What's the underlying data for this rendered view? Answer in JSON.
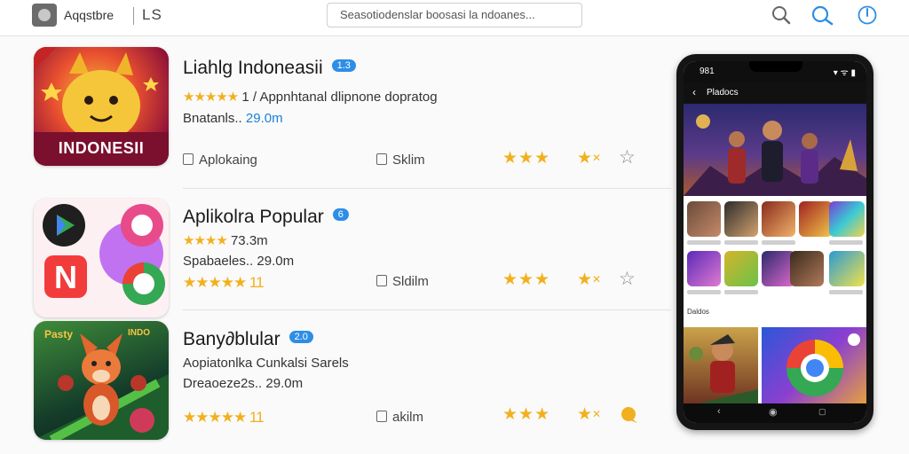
{
  "header": {
    "app_title": "Aqqstbre",
    "app_sub": "LS",
    "search_placeholder": "Seasotiodenslar boosasi la ndoanes..."
  },
  "apps": [
    {
      "name": "Liahlg Indoneasii",
      "badge": "1.3",
      "rating_stars": "★★★★★",
      "subtitle": "1 / Appnhtanal dlipnone dopratog",
      "stat_label": "Bnatanls..",
      "stat_value": "29.0m",
      "extra_line": "",
      "action": "Aplokaing",
      "size": "Sklim",
      "thumb_text": "INDONESII"
    },
    {
      "name": "Aplikolra Popular",
      "badge": "6",
      "rating_stars": "★★★★",
      "subtitle": "73.3m",
      "stat_label": "Spabaeles..",
      "stat_value": "29.0m",
      "extra_line": "★★★★★ 11",
      "action": "",
      "size": "Sldilm",
      "thumb_text": ""
    },
    {
      "name": "Bany∂blular",
      "badge": "2.0",
      "rating_stars": "",
      "subtitle": "Aopiatonlka Cunkalsi Sarels",
      "stat_label": "Dreaoeze2s..",
      "stat_value": "29.0m",
      "extra_line": "★★★★★ 11",
      "action": "",
      "size": "akilm",
      "thumb_text": "INDO"
    }
  ],
  "phone": {
    "time": "981",
    "status_icons": "▾ ᯤ ▮",
    "screen_title": "Pladocs",
    "section_label": "Daldos"
  },
  "colors": {
    "star": "#f2b01e",
    "accent": "#2d8ee6",
    "link": "#1b7fd6"
  }
}
